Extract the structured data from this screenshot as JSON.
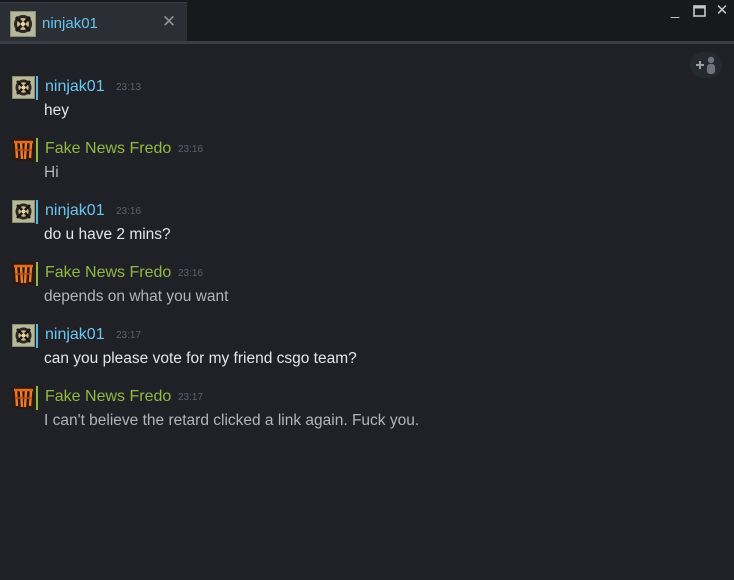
{
  "tab": {
    "name": "ninjak01",
    "close_icon": "close-icon"
  },
  "window_controls": {
    "minimize": "minimize-icon",
    "maximize": "maximize-icon",
    "close": "close-icon"
  },
  "add_friend_button": {
    "icon": "add-friend-icon"
  },
  "colors": {
    "self_name": "#6bc5f0",
    "friend_name": "#8fb942",
    "background": "#1f2126"
  },
  "messages": [
    {
      "sender": "ninjak01",
      "time": "23:13",
      "text": "hey",
      "side": "self"
    },
    {
      "sender": "Fake News Fredo",
      "time": "23:16",
      "text": "Hi",
      "side": "other"
    },
    {
      "sender": "ninjak01",
      "time": "23:16",
      "text": "do u have 2 mins?",
      "side": "self"
    },
    {
      "sender": "Fake News Fredo",
      "time": "23:16",
      "text": "depends on what you want",
      "side": "other"
    },
    {
      "sender": "ninjak01",
      "time": "23:17",
      "text": "can you please vote for my friend csgo team?",
      "side": "self"
    },
    {
      "sender": "Fake News Fredo",
      "time": "23:17",
      "text": "I can't believe the retard clicked a link again. Fuck you.",
      "side": "other"
    }
  ]
}
